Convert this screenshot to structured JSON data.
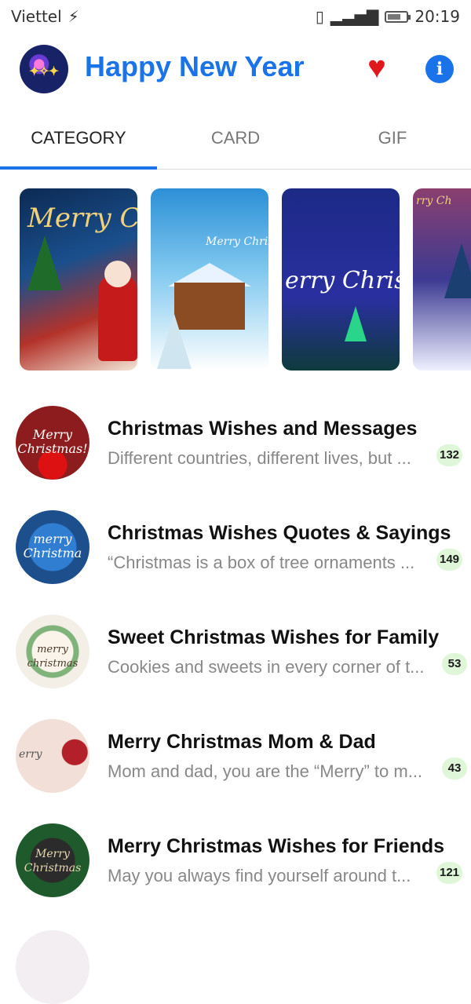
{
  "status_bar": {
    "carrier": "Viettel",
    "time": "20:19"
  },
  "app": {
    "title": "Happy New Year"
  },
  "tabs": [
    {
      "label": "CATEGORY"
    },
    {
      "label": "CARD"
    },
    {
      "label": "GIF"
    }
  ],
  "carousel": [
    {
      "caption": "Merry C"
    },
    {
      "caption": "Merry Christmas"
    },
    {
      "caption": "erry Chris"
    },
    {
      "caption": "rry Ch"
    }
  ],
  "categories": [
    {
      "title": "Christmas Wishes and Messages",
      "subtitle": "Different countries, different lives, but ...",
      "count": "132",
      "avatar_text": "Merry Christmas!"
    },
    {
      "title": "Christmas Wishes Quotes & Sayings",
      "subtitle": "“Christmas is a box of tree ornaments ...",
      "count": "149",
      "avatar_text": "merry Christma"
    },
    {
      "title": "Sweet Christmas Wishes for Family",
      "subtitle": "Cookies and sweets in every corner of t...",
      "count": "53",
      "avatar_text": "merry christmas"
    },
    {
      "title": "Merry Christmas Mom & Dad",
      "subtitle": "Mom and dad, you are the “Merry” to m...",
      "count": "43",
      "avatar_text": "erry"
    },
    {
      "title": "Merry Christmas Wishes for Friends",
      "subtitle": "May you always find yourself around t...",
      "count": "121",
      "avatar_text": "Merry Christmas"
    }
  ],
  "colors": {
    "accent": "#1a73e8",
    "heart": "#e0181b",
    "badge_bg": "#dff7d8"
  }
}
